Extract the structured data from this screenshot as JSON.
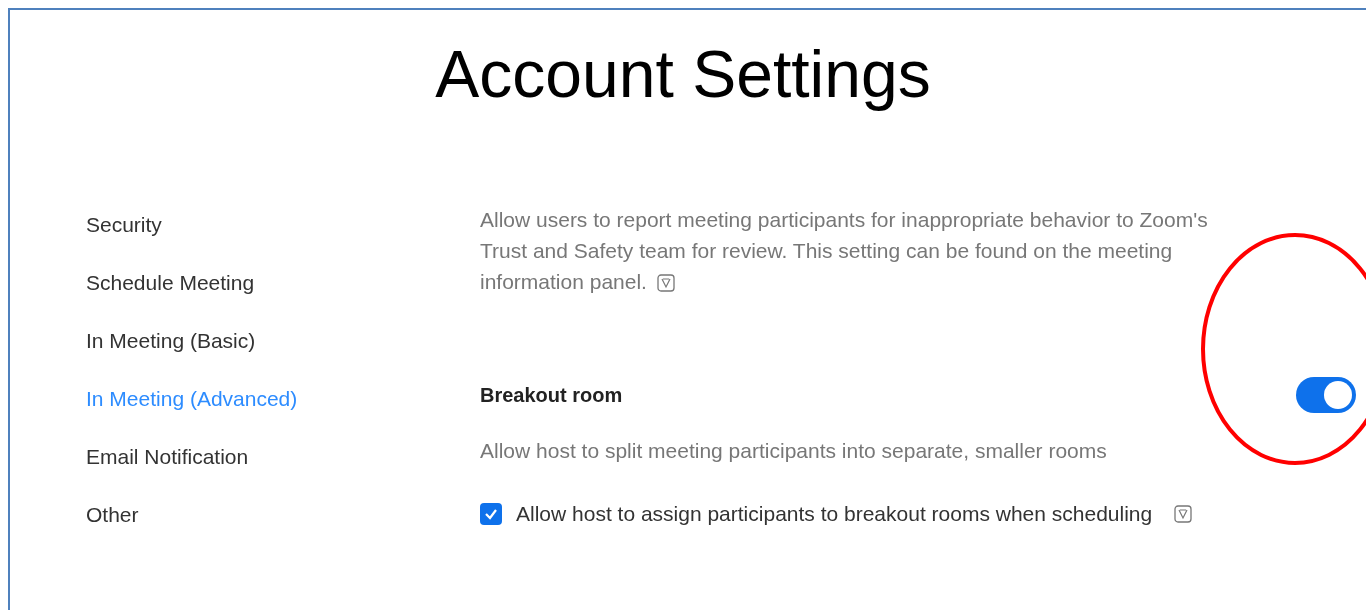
{
  "title": "Account Settings",
  "sidebar": {
    "items": [
      {
        "label": "Security",
        "selected": false
      },
      {
        "label": "Schedule Meeting",
        "selected": false
      },
      {
        "label": "In Meeting (Basic)",
        "selected": false
      },
      {
        "label": "In Meeting (Advanced)",
        "selected": true
      },
      {
        "label": "Email Notification",
        "selected": false
      },
      {
        "label": "Other",
        "selected": false
      }
    ]
  },
  "settings": [
    {
      "description": "Allow users to report meeting participants for inappropriate behavior to Zoom's Trust and Safety team for review. This setting can be found on the meeting information panel.",
      "info_icon": true
    },
    {
      "name": "Breakout room",
      "on": true,
      "description": "Allow host to split meeting participants into separate, smaller rooms",
      "options": [
        {
          "label": "Allow host to assign participants to breakout rooms when scheduling",
          "checked": true,
          "info_icon": true
        }
      ]
    }
  ],
  "annotation": {
    "kind": "circle",
    "color": "#ff0000"
  }
}
